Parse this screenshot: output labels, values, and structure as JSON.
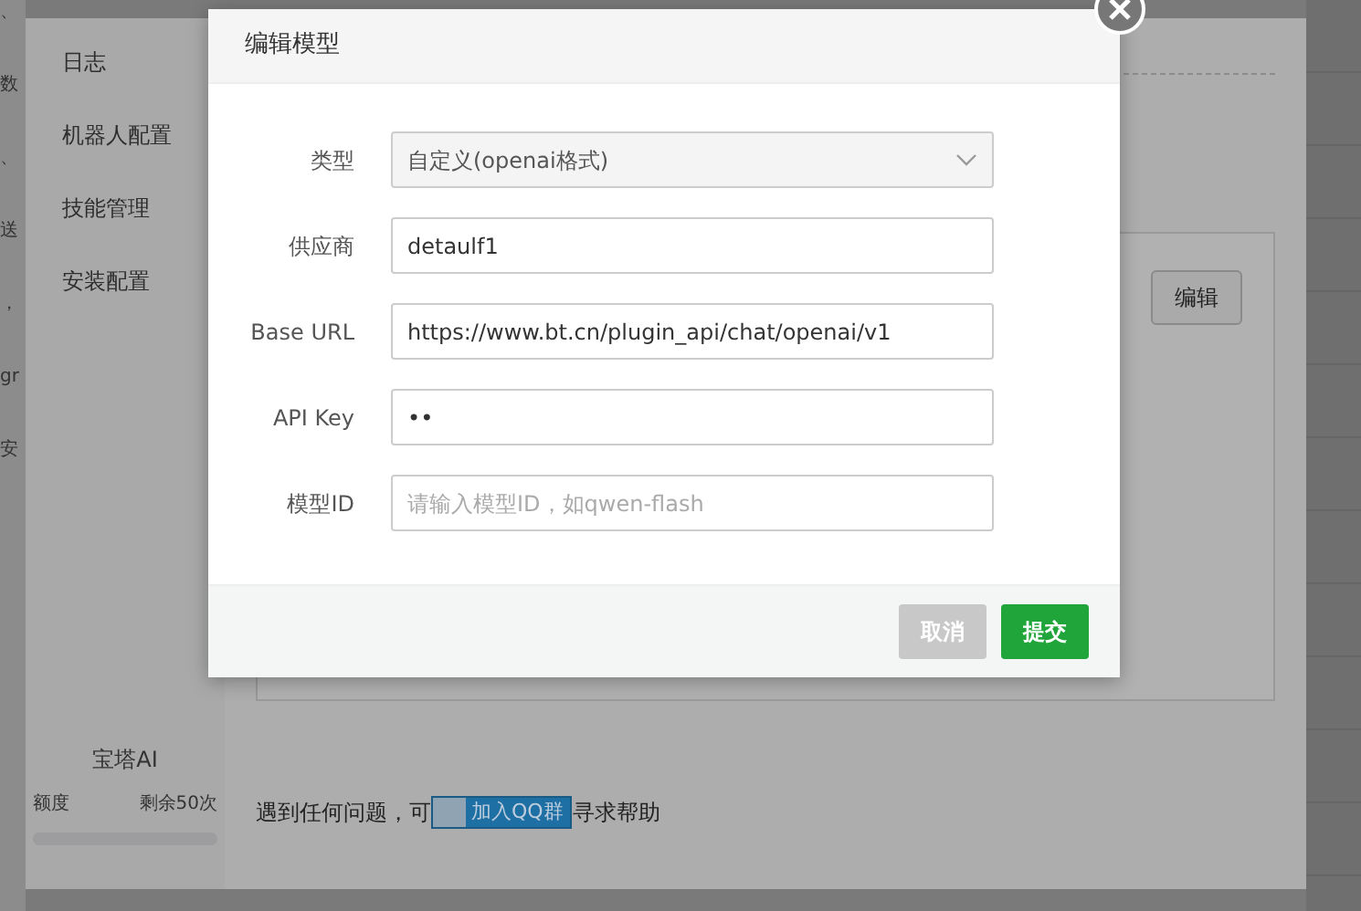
{
  "background_fragments": [
    "、",
    "数",
    "、",
    "送",
    "，",
    "gr",
    "安"
  ],
  "sidebar": {
    "items": [
      {
        "label": "日志"
      },
      {
        "label": "机器人配置"
      },
      {
        "label": "技能管理"
      },
      {
        "label": "安装配置"
      }
    ],
    "footer": {
      "title": "宝塔AI",
      "quota_label": "额度",
      "remaining": "剩余50次",
      "level": 0
    }
  },
  "content": {
    "edit_button": "编辑",
    "help": {
      "before": "遇到任何问题，可",
      "badge": "加入QQ群",
      "after": "寻求帮助"
    }
  },
  "modal": {
    "title": "编辑模型",
    "fields": [
      {
        "kind": "select",
        "label": "类型",
        "value": "自定义(openai格式)"
      },
      {
        "kind": "text",
        "label": "供应商",
        "value": "detaulf1"
      },
      {
        "kind": "text",
        "label": "Base URL",
        "value": "https://www.bt.cn/plugin_api/chat/openai/v1"
      },
      {
        "kind": "text",
        "label": "API Key",
        "value": "••"
      },
      {
        "kind": "text",
        "label": "模型ID",
        "placeholder": "请输入模型ID，如qwen-flash"
      }
    ],
    "buttons": [
      {
        "kind": "cancel",
        "label": "取消"
      },
      {
        "kind": "submit",
        "label": "提交"
      }
    ]
  }
}
